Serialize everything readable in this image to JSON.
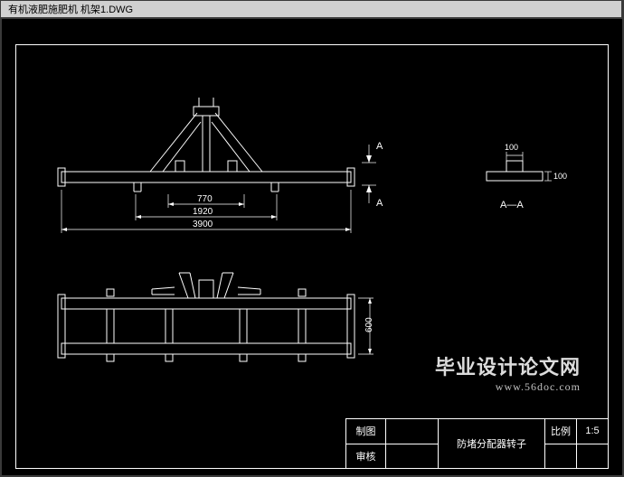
{
  "title_bar": "有机液肥施肥机  机架1.DWG",
  "dimensions": {
    "width_inner": "770",
    "width_mid": "1920",
    "width_total": "3900",
    "small_top": "100",
    "small_side": "100",
    "bottom_height": "600"
  },
  "section": {
    "mark_top": "A",
    "mark_bottom": "A",
    "label": "A—A"
  },
  "title_block": {
    "row1_label": "制图",
    "row1_value": "",
    "row2_label": "审核",
    "row2_value": "",
    "drawing_title": "防堵分配器转子",
    "scale_label": "比例",
    "scale_value": "1:5"
  },
  "watermark": {
    "line1": "毕业设计论文网",
    "line2": "www.56doc.com"
  }
}
